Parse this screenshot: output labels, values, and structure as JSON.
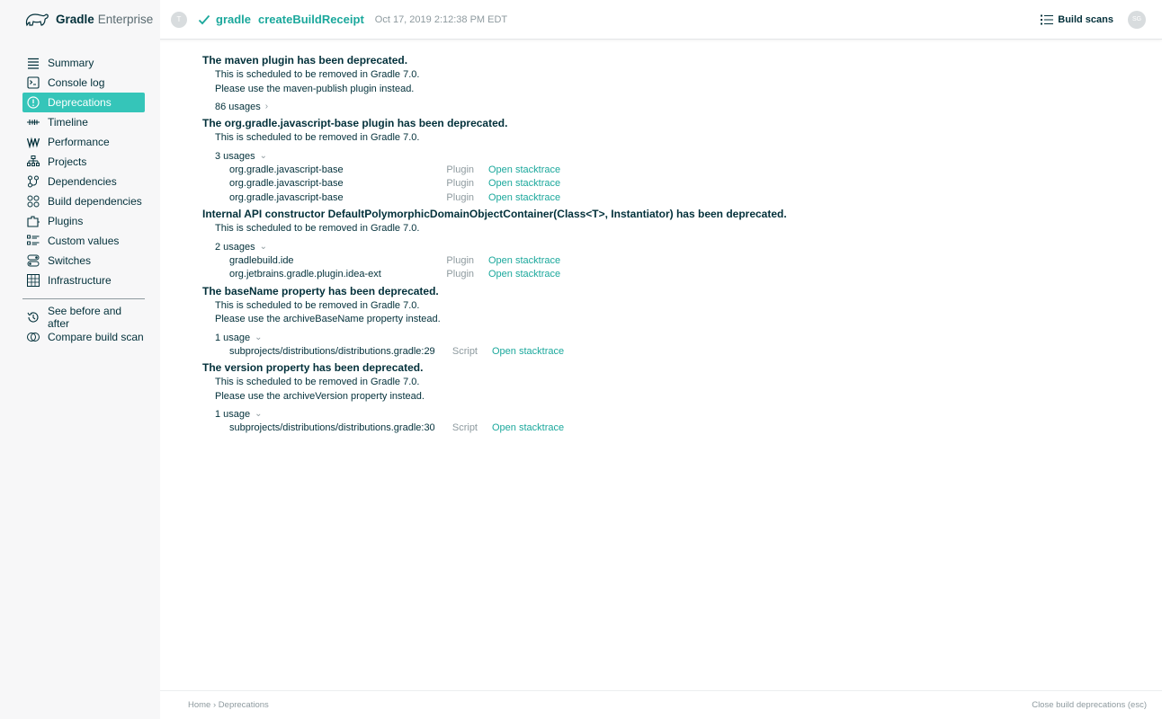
{
  "brand": {
    "bold": "Gradle",
    "light": "Enterprise"
  },
  "header": {
    "user_initial": "T",
    "project": "gradle",
    "task": "createBuildReceipt",
    "date": "Oct 17, 2019 2:12:38 PM EDT",
    "build_scans_label": "Build scans",
    "account_initials": "SG"
  },
  "sidebar": {
    "items": [
      {
        "label": "Summary",
        "icon": "summary-icon"
      },
      {
        "label": "Console log",
        "icon": "console-icon"
      },
      {
        "label": "Deprecations",
        "icon": "warning-circle-icon",
        "active": true
      },
      {
        "label": "Timeline",
        "icon": "timeline-icon"
      },
      {
        "label": "Performance",
        "icon": "performance-icon"
      },
      {
        "label": "Projects",
        "icon": "projects-icon"
      },
      {
        "label": "Dependencies",
        "icon": "dependencies-icon"
      },
      {
        "label": "Build dependencies",
        "icon": "build-dependencies-icon"
      },
      {
        "label": "Plugins",
        "icon": "plugins-icon"
      },
      {
        "label": "Custom values",
        "icon": "custom-values-icon"
      },
      {
        "label": "Switches",
        "icon": "switches-icon"
      },
      {
        "label": "Infrastructure",
        "icon": "infrastructure-icon"
      }
    ],
    "secondary": [
      {
        "label": "See before and after",
        "icon": "history-icon"
      },
      {
        "label": "Compare build scan",
        "icon": "compare-icon"
      }
    ]
  },
  "deprecations": [
    {
      "title": "The maven plugin has been deprecated.",
      "lines": [
        "This is scheduled to be removed in Gradle 7.0.",
        "Please use the maven-publish plugin instead."
      ],
      "usages_label": "86 usages",
      "expanded": false,
      "usages": []
    },
    {
      "title": "The org.gradle.javascript-base plugin has been deprecated.",
      "lines": [
        "This is scheduled to be removed in Gradle 7.0."
      ],
      "usages_label": "3 usages",
      "expanded": true,
      "usages": [
        {
          "name": "org.gradle.javascript-base",
          "type": "Plugin",
          "link": "Open stacktrace"
        },
        {
          "name": "org.gradle.javascript-base",
          "type": "Plugin",
          "link": "Open stacktrace"
        },
        {
          "name": "org.gradle.javascript-base",
          "type": "Plugin",
          "link": "Open stacktrace"
        }
      ]
    },
    {
      "title": "Internal API constructor DefaultPolymorphicDomainObjectContainer(Class<T>, Instantiator) has been deprecated.",
      "lines": [
        "This is scheduled to be removed in Gradle 7.0."
      ],
      "usages_label": "2 usages",
      "expanded": true,
      "usages": [
        {
          "name": "gradlebuild.ide",
          "type": "Plugin",
          "link": "Open stacktrace"
        },
        {
          "name": "org.jetbrains.gradle.plugin.idea-ext",
          "type": "Plugin",
          "link": "Open stacktrace"
        }
      ]
    },
    {
      "title": "The baseName property has been deprecated.",
      "lines": [
        "This is scheduled to be removed in Gradle 7.0.",
        "Please use the archiveBaseName property instead."
      ],
      "usages_label": "1 usage",
      "expanded": true,
      "usages": [
        {
          "name": "subprojects/distributions/distributions.gradle:29",
          "type": "Script",
          "link": "Open stacktrace"
        }
      ]
    },
    {
      "title": "The version property has been deprecated.",
      "lines": [
        "This is scheduled to be removed in Gradle 7.0.",
        "Please use the archiveVersion property instead."
      ],
      "usages_label": "1 usage",
      "expanded": true,
      "usages": [
        {
          "name": "subprojects/distributions/distributions.gradle:30",
          "type": "Script",
          "link": "Open stacktrace"
        }
      ]
    }
  ],
  "footer": {
    "crumbs": [
      "Home",
      "Deprecations"
    ],
    "crumb_separator": "›",
    "close_label": "Close build deprecations (esc)"
  },
  "colors": {
    "accent": "#35c5b9",
    "link": "#1ba89c",
    "text": "#02303a",
    "muted": "#8e9a9f"
  }
}
